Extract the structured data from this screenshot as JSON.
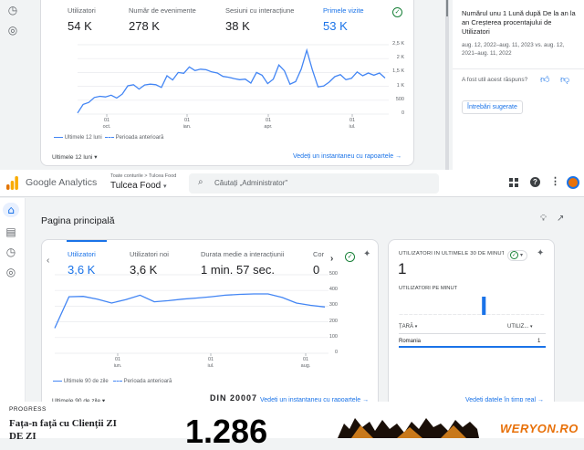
{
  "top_card": {
    "metrics": [
      {
        "label": "Utilizatori",
        "value": "54 K",
        "active": false
      },
      {
        "label": "Număr de evenimente",
        "value": "278 K",
        "active": false
      },
      {
        "label": "Sesiuni cu interacțiune",
        "value": "38 K",
        "active": false
      },
      {
        "label": "Primele vizite",
        "value": "53 K",
        "active": true
      }
    ],
    "x_ticks": [
      {
        "day": "01",
        "month": "oct."
      },
      {
        "day": "01",
        "month": "ian."
      },
      {
        "day": "01",
        "month": "apr."
      },
      {
        "day": "01",
        "month": "iul."
      }
    ],
    "legend_current": "Ultimele 12 luni",
    "legend_previous": "Perioada anterioară",
    "date_range": "Ultimele 12 luni",
    "snapshot_link": "Vedeți un instantaneu cu rapoartele"
  },
  "top_chart_data": {
    "type": "line",
    "y_ticks": [
      "2,5 K",
      "2 K",
      "1,5 K",
      "1 K",
      "500",
      "0"
    ],
    "ylim": [
      0,
      2500
    ],
    "values": [
      40,
      350,
      420,
      600,
      640,
      620,
      680,
      580,
      720,
      1020,
      1060,
      900,
      1050,
      1080,
      1060,
      960,
      1380,
      1230,
      1500,
      1470,
      1700,
      1570,
      1620,
      1600,
      1520,
      1480,
      1360,
      1330,
      1280,
      1240,
      1260,
      1120,
      1500,
      1400,
      1100,
      1260,
      1770,
      1560,
      1080,
      1170,
      1620,
      2300,
      1600,
      980,
      1010,
      1150,
      1350,
      1420,
      1240,
      1290,
      1520,
      1380,
      1480,
      1400,
      1480,
      1300
    ]
  },
  "insight": {
    "text": "Numărul unu 1 Lună după De la an la an Creșterea procentajului de Utilizatori",
    "date_text": "aug. 12, 2022–aug. 11, 2023 vs. aug. 12, 2021–aug. 11, 2022",
    "question": "A fost util acest răspuns?",
    "button": "Întrebări sugerate"
  },
  "header": {
    "app_name": "Google Analytics",
    "breadcrumb": "Toate conturile > Tulcea Food",
    "property": "Tulcea Food",
    "search_placeholder": "Căutați „Administrator\""
  },
  "page": {
    "title": "Pagina principală"
  },
  "main_card": {
    "metrics": [
      {
        "label": "Utilizatori",
        "value": "3,6 K",
        "active": true
      },
      {
        "label": "Utilizatori noi",
        "value": "3,6 K",
        "active": false
      },
      {
        "label": "Durata medie a interacțiunii",
        "value": "1 min. 57 sec.",
        "active": false
      },
      {
        "label": "Cor",
        "value": "0",
        "active": false
      }
    ],
    "x_ticks": [
      {
        "day": "01",
        "month": "iun."
      },
      {
        "day": "01",
        "month": "iul."
      },
      {
        "day": "01",
        "month": "aug."
      }
    ],
    "legend_current": "Ultimele 90 de zile",
    "legend_previous": "Perioada anterioară",
    "date_range": "Ultimele 90 de zile",
    "snapshot_link": "Vedeți un instantaneu cu rapoartele"
  },
  "chart_data": {
    "type": "line",
    "y_ticks": [
      "500",
      "400",
      "300",
      "200",
      "100",
      "0"
    ],
    "ylim": [
      0,
      500
    ],
    "values": [
      160,
      360,
      362,
      345,
      320,
      342,
      370,
      328,
      335,
      345,
      352,
      360,
      370,
      375,
      378,
      378,
      355,
      320,
      305,
      295
    ]
  },
  "realtime_card": {
    "title": "UTILIZATORI ÎN ULTIMELE 30 DE MINUTE",
    "value": "1",
    "per_minute_label": "UTILIZATORI PE MINUT",
    "bar_values": [
      0,
      0,
      0,
      0,
      0,
      0,
      0,
      0,
      0,
      0,
      0,
      0,
      0,
      0,
      0,
      0,
      0,
      1,
      0,
      0,
      0,
      0,
      0,
      0,
      0,
      0,
      0,
      0,
      0,
      0
    ],
    "table_header_country": "ȚARĂ",
    "table_header_users": "UTILIZ...",
    "rows": [
      {
        "country": "Romania",
        "users": "1"
      }
    ],
    "realtime_link": "Vedeți datele în timp real"
  },
  "bottom_strip": {
    "label": "PROGRESS",
    "headline_1": "Fața-n față cu Clienții ZI",
    "headline_2": "DE ZI",
    "overlay": "DIN 20007",
    "big_number": "1.286",
    "logo": "WERYON.RO"
  },
  "colors": {
    "accent": "#1a73e8",
    "success": "#188038",
    "logo_text": "#e8710a"
  }
}
